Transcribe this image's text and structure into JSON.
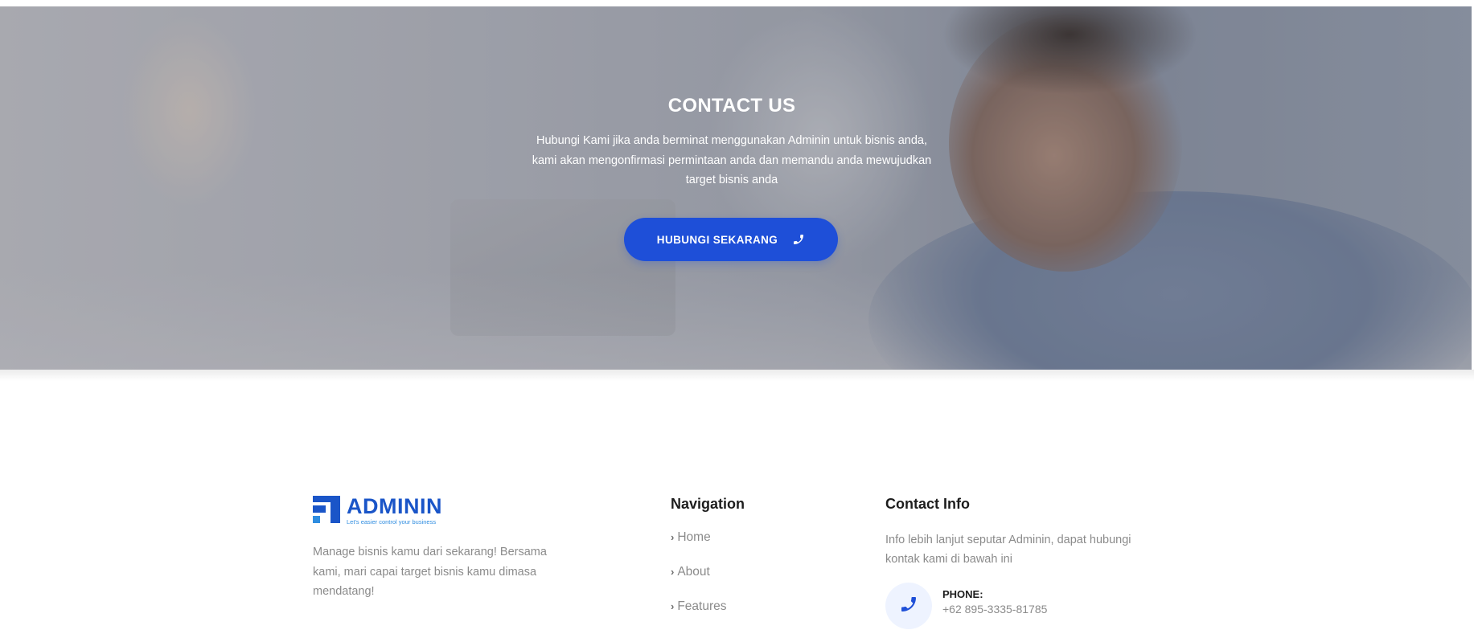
{
  "hero": {
    "title": "CONTACT US",
    "description": "Hubungi Kami jika anda berminat menggunakan Adminin untuk bisnis anda, kami akan mengonfirmasi permintaan anda dan memandu anda mewujudkan target bisnis anda",
    "button_label": "HUBUNGI SEKARANG",
    "button_icon": "phone-icon",
    "button_color": "#1e4fd8"
  },
  "footer": {
    "logo": {
      "name": "ADMININ",
      "tagline": "Let's easier control your business",
      "color": "#1a55c8"
    },
    "about": "Manage bisnis kamu dari sekarang! Bersama kami, mari capai target bisnis kamu dimasa mendatang!",
    "navigation": {
      "title": "Navigation",
      "items": [
        {
          "label": "Home"
        },
        {
          "label": "About"
        },
        {
          "label": "Features"
        }
      ]
    },
    "contact": {
      "title": "Contact Info",
      "description": "Info lebih lanjut seputar Adminin, dapat hubungi kontak kami di bawah ini",
      "phone_label": "PHONE:",
      "phone_value": "+62 895-3335-81785",
      "phone_icon": "phone-icon"
    }
  }
}
